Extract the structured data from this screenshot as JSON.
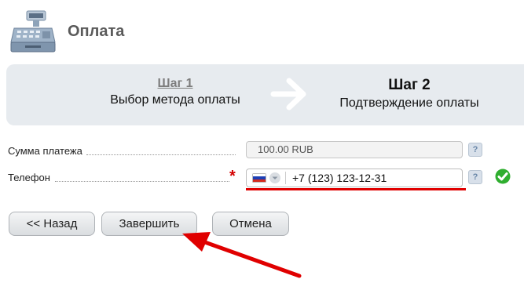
{
  "header": {
    "title": "Оплата",
    "icon": "cash-register-icon"
  },
  "steps": {
    "step1": {
      "title": "Шаг 1",
      "description": "Выбор метода оплаты"
    },
    "separator_icon": "arrow-right-icon",
    "step2": {
      "title": "Шаг 2",
      "description": "Подтверждение оплаты"
    }
  },
  "form": {
    "amount": {
      "label": "Сумма платежа",
      "value": "100.00 RUB",
      "help": "?"
    },
    "phone": {
      "label": "Телефон",
      "required_mark": "*",
      "country_flag": "russia-flag-icon",
      "value": "+7 (123) 123-12-31",
      "help": "?",
      "status_icon": "valid-check-icon"
    }
  },
  "buttons": {
    "back": "<< Назад",
    "finish": "Завершить",
    "cancel": "Отмена"
  },
  "colors": {
    "steps_bg": "#e7ebef",
    "required": "#d40000",
    "valid": "#2fae2f",
    "annotation": "#e00000"
  }
}
